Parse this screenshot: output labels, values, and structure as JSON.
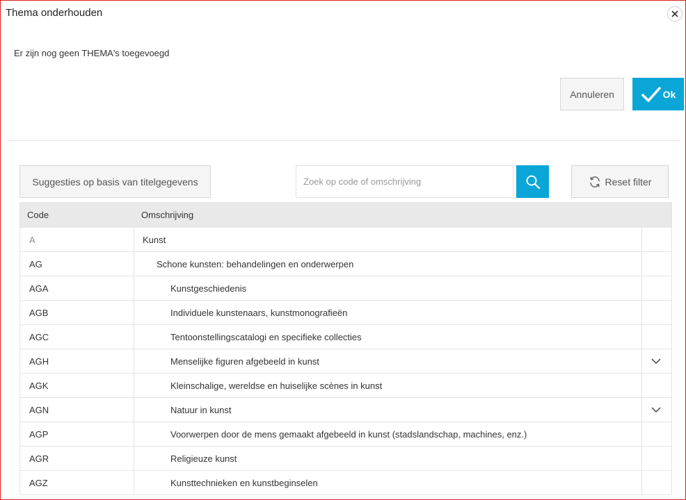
{
  "dialog": {
    "title": "Thema onderhouden",
    "message": "Er zijn nog geen THEMA's toegevoegd",
    "cancel_label": "Annuleren",
    "ok_label": "Ok"
  },
  "toolbar": {
    "suggest_label": "Suggesties op basis van titelgegevens",
    "search_placeholder": "Zoek op code of omschrijving",
    "search_value": "",
    "reset_label": "Reset filter"
  },
  "table": {
    "headers": {
      "code": "Code",
      "desc": "Omschrijving"
    },
    "rows": [
      {
        "code": "A",
        "desc": "Kunst",
        "level": 0,
        "expandable": false
      },
      {
        "code": "AG",
        "desc": "Schone kunsten: behandelingen en onderwerpen",
        "level": 1,
        "expandable": false
      },
      {
        "code": "AGA",
        "desc": "Kunstgeschiedenis",
        "level": 2,
        "expandable": false
      },
      {
        "code": "AGB",
        "desc": "Individuele kunstenaars, kunstmonografieën",
        "level": 2,
        "expandable": false
      },
      {
        "code": "AGC",
        "desc": "Tentoonstellingscatalogi en specifieke collecties",
        "level": 2,
        "expandable": false
      },
      {
        "code": "AGH",
        "desc": "Menselijke figuren afgebeeld in kunst",
        "level": 2,
        "expandable": true
      },
      {
        "code": "AGK",
        "desc": "Kleinschalige, wereldse en huiselijke scènes in kunst",
        "level": 2,
        "expandable": false
      },
      {
        "code": "AGN",
        "desc": "Natuur in kunst",
        "level": 2,
        "expandable": true
      },
      {
        "code": "AGP",
        "desc": "Voorwerpen door de mens gemaakt afgebeeld in kunst (stadslandschap, machines, enz.)",
        "level": 2,
        "expandable": false
      },
      {
        "code": "AGR",
        "desc": "Religieuze kunst",
        "level": 2,
        "expandable": false
      },
      {
        "code": "AGZ",
        "desc": "Kunsttechnieken en kunstbeginselen",
        "level": 2,
        "expandable": false
      }
    ]
  },
  "colors": {
    "accent": "#0aa6d8",
    "border_red": "#e01b1b"
  },
  "icons": {
    "close": "close-icon",
    "ok": "checkmark-icon",
    "search": "search-icon",
    "reset": "refresh-icon",
    "expand": "chevron-down-icon"
  }
}
